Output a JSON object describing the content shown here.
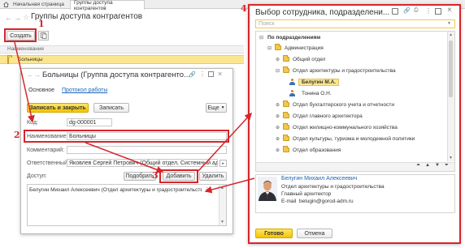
{
  "tabs": {
    "home": "Начальная страница",
    "groups": "Группы доступа контрагентов"
  },
  "list": {
    "title": "Группы доступа контрагентов",
    "create": "Создать",
    "column_name": "Наименование",
    "row": "Больницы"
  },
  "form": {
    "title": "Больницы (Группа доступа контрагенто...",
    "tab_main": "Основное",
    "tab_log": "Протокол работы",
    "save_close": "Записать и закрыть",
    "save": "Записать",
    "more": "Еще",
    "code_label": "Код:",
    "code_value": "dg-000001",
    "name_label": "Наименование:",
    "name_value": "Больницы",
    "comment_label": "Комментарий:",
    "responsible_label": "Ответственный:",
    "responsible_value": "Яковлев Сергей Петрович (Общий отдел, Системный адми...",
    "access_label": "Доступ:",
    "pick": "Подобрать",
    "add": "Добавить",
    "remove": "Удалить",
    "access_entry": "Белугин Михаил Алексеевич (Отдел архитектуры и градостроительства)"
  },
  "picker": {
    "title": "Выбор сотрудника, подразделени...",
    "search_placeholder": "Поиск",
    "tree": [
      {
        "label": "По подразделениям",
        "level": 0,
        "kind": "root",
        "toggle": "⊟",
        "bold": true
      },
      {
        "label": "Администрация",
        "level": 1,
        "kind": "folder",
        "toggle": "⊟"
      },
      {
        "label": "Общий отдел",
        "level": 2,
        "kind": "folder",
        "toggle": "⊕"
      },
      {
        "label": "Отдел архитектуры и градостроительства",
        "level": 2,
        "kind": "folder",
        "toggle": "⊟"
      },
      {
        "label": "Белугин М.А.",
        "level": 3,
        "kind": "person",
        "toggle": "",
        "selected": true
      },
      {
        "label": "Тонина О.Н.",
        "level": 3,
        "kind": "person",
        "toggle": ""
      },
      {
        "label": "Отдел бухгалтерского учета и отчетности",
        "level": 2,
        "kind": "folder",
        "toggle": "⊕"
      },
      {
        "label": "Отдел главного архитектора",
        "level": 2,
        "kind": "folder",
        "toggle": "⊕"
      },
      {
        "label": "Отдел жилищно-коммунального хозяйства",
        "level": 2,
        "kind": "folder",
        "toggle": "⊕"
      },
      {
        "label": "Отдел культуры, туризма и молодежной политики",
        "level": 2,
        "kind": "folder",
        "toggle": "⊕"
      },
      {
        "label": "Отдел образования",
        "level": 2,
        "kind": "folder",
        "toggle": "⊕"
      }
    ],
    "card": {
      "name": "Белугин Михаил Алексеевич",
      "dept": "Отдел архитектуры и градостроительства",
      "position": "Главный архитектор",
      "email": "E-mail  belugin@gorod-adm.ru"
    },
    "done": "Готово",
    "cancel": "Отмена"
  },
  "steps": [
    "1",
    "2",
    "3",
    "4"
  ],
  "colors": {
    "accent_red": "#d6252b",
    "yellow": "#f5c400",
    "selected_row": "#fbe68f",
    "link": "#1a63b8"
  }
}
